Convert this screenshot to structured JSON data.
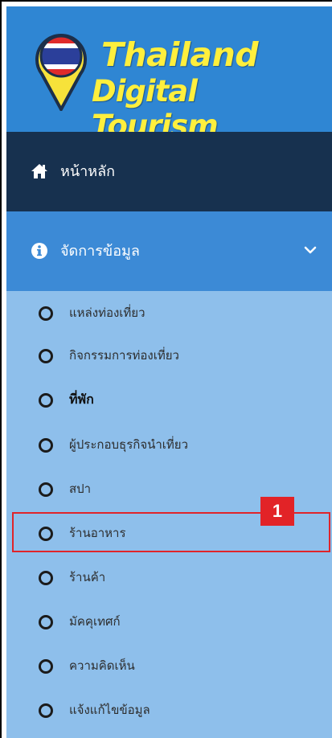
{
  "brand": {
    "line1": "Thailand",
    "line2": "Digital Tourism",
    "colors": {
      "text": "#ffef3d",
      "background": "#2f86d3"
    }
  },
  "nav": {
    "home": {
      "label": "หน้าหลัก",
      "icon": "home-icon"
    },
    "manage": {
      "label": "จัดการข้อมูล",
      "icon": "info-icon",
      "expanded": true,
      "chevron": "chevron-down-icon"
    }
  },
  "submenu": {
    "items": [
      {
        "label": "แหล่งท่องเที่ยว",
        "icon": "circle-icon"
      },
      {
        "label": "กิจกรรมการท่องเที่ยว",
        "icon": "circle-icon"
      },
      {
        "label": "ที่พัก",
        "icon": "circle-icon",
        "active": true
      },
      {
        "label": "ผู้ประกอบธุรกิจนำเที่ยว",
        "icon": "circle-icon"
      },
      {
        "label": "สปา",
        "icon": "circle-icon"
      },
      {
        "label": "ร้านอาหาร",
        "icon": "circle-icon"
      },
      {
        "label": "ร้านค้า",
        "icon": "circle-icon"
      },
      {
        "label": "มัคคุเทศก์",
        "icon": "circle-icon"
      },
      {
        "label": "ความคิดเห็น",
        "icon": "circle-icon"
      },
      {
        "label": "แจ้งแก้ไขข้อมูล",
        "icon": "circle-icon"
      }
    ]
  },
  "annotation": {
    "callout_label": "1",
    "color": "#e22327"
  }
}
